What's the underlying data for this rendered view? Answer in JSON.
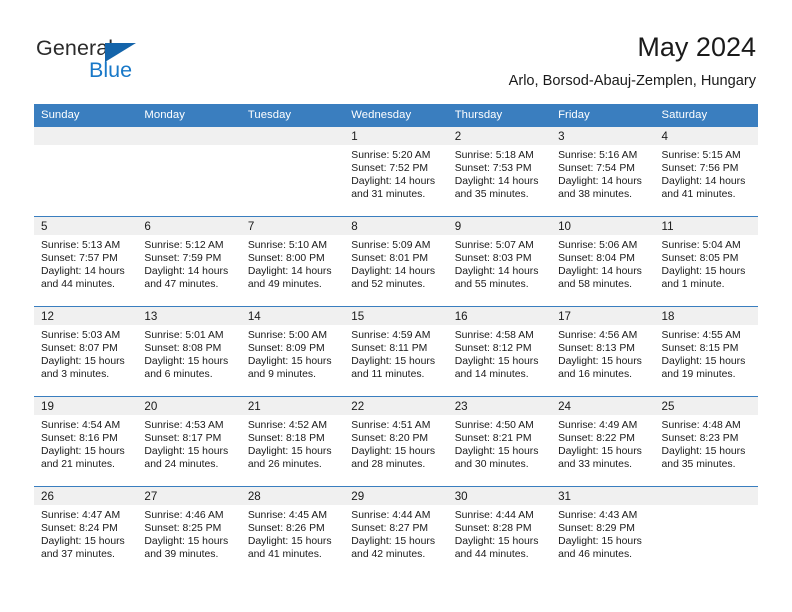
{
  "brand": {
    "word1": "General",
    "word2": "Blue",
    "accent_color": "#1878c8",
    "triangle_color": "#1464aa"
  },
  "header": {
    "month_title": "May 2024",
    "location": "Arlo, Borsod-Abauj-Zemplen, Hungary"
  },
  "calendar": {
    "header_color": "#3a7ebf",
    "weekdays": [
      "Sunday",
      "Monday",
      "Tuesday",
      "Wednesday",
      "Thursday",
      "Friday",
      "Saturday"
    ],
    "leading_blanks": 3,
    "weeks": [
      [
        {
          "blank": true
        },
        {
          "blank": true
        },
        {
          "blank": true
        },
        {
          "day": "1",
          "sunrise": "Sunrise: 5:20 AM",
          "sunset": "Sunset: 7:52 PM",
          "daylight1": "Daylight: 14 hours",
          "daylight2": "and 31 minutes."
        },
        {
          "day": "2",
          "sunrise": "Sunrise: 5:18 AM",
          "sunset": "Sunset: 7:53 PM",
          "daylight1": "Daylight: 14 hours",
          "daylight2": "and 35 minutes."
        },
        {
          "day": "3",
          "sunrise": "Sunrise: 5:16 AM",
          "sunset": "Sunset: 7:54 PM",
          "daylight1": "Daylight: 14 hours",
          "daylight2": "and 38 minutes."
        },
        {
          "day": "4",
          "sunrise": "Sunrise: 5:15 AM",
          "sunset": "Sunset: 7:56 PM",
          "daylight1": "Daylight: 14 hours",
          "daylight2": "and 41 minutes."
        }
      ],
      [
        {
          "day": "5",
          "sunrise": "Sunrise: 5:13 AM",
          "sunset": "Sunset: 7:57 PM",
          "daylight1": "Daylight: 14 hours",
          "daylight2": "and 44 minutes."
        },
        {
          "day": "6",
          "sunrise": "Sunrise: 5:12 AM",
          "sunset": "Sunset: 7:59 PM",
          "daylight1": "Daylight: 14 hours",
          "daylight2": "and 47 minutes."
        },
        {
          "day": "7",
          "sunrise": "Sunrise: 5:10 AM",
          "sunset": "Sunset: 8:00 PM",
          "daylight1": "Daylight: 14 hours",
          "daylight2": "and 49 minutes."
        },
        {
          "day": "8",
          "sunrise": "Sunrise: 5:09 AM",
          "sunset": "Sunset: 8:01 PM",
          "daylight1": "Daylight: 14 hours",
          "daylight2": "and 52 minutes."
        },
        {
          "day": "9",
          "sunrise": "Sunrise: 5:07 AM",
          "sunset": "Sunset: 8:03 PM",
          "daylight1": "Daylight: 14 hours",
          "daylight2": "and 55 minutes."
        },
        {
          "day": "10",
          "sunrise": "Sunrise: 5:06 AM",
          "sunset": "Sunset: 8:04 PM",
          "daylight1": "Daylight: 14 hours",
          "daylight2": "and 58 minutes."
        },
        {
          "day": "11",
          "sunrise": "Sunrise: 5:04 AM",
          "sunset": "Sunset: 8:05 PM",
          "daylight1": "Daylight: 15 hours",
          "daylight2": "and 1 minute."
        }
      ],
      [
        {
          "day": "12",
          "sunrise": "Sunrise: 5:03 AM",
          "sunset": "Sunset: 8:07 PM",
          "daylight1": "Daylight: 15 hours",
          "daylight2": "and 3 minutes."
        },
        {
          "day": "13",
          "sunrise": "Sunrise: 5:01 AM",
          "sunset": "Sunset: 8:08 PM",
          "daylight1": "Daylight: 15 hours",
          "daylight2": "and 6 minutes."
        },
        {
          "day": "14",
          "sunrise": "Sunrise: 5:00 AM",
          "sunset": "Sunset: 8:09 PM",
          "daylight1": "Daylight: 15 hours",
          "daylight2": "and 9 minutes."
        },
        {
          "day": "15",
          "sunrise": "Sunrise: 4:59 AM",
          "sunset": "Sunset: 8:11 PM",
          "daylight1": "Daylight: 15 hours",
          "daylight2": "and 11 minutes."
        },
        {
          "day": "16",
          "sunrise": "Sunrise: 4:58 AM",
          "sunset": "Sunset: 8:12 PM",
          "daylight1": "Daylight: 15 hours",
          "daylight2": "and 14 minutes."
        },
        {
          "day": "17",
          "sunrise": "Sunrise: 4:56 AM",
          "sunset": "Sunset: 8:13 PM",
          "daylight1": "Daylight: 15 hours",
          "daylight2": "and 16 minutes."
        },
        {
          "day": "18",
          "sunrise": "Sunrise: 4:55 AM",
          "sunset": "Sunset: 8:15 PM",
          "daylight1": "Daylight: 15 hours",
          "daylight2": "and 19 minutes."
        }
      ],
      [
        {
          "day": "19",
          "sunrise": "Sunrise: 4:54 AM",
          "sunset": "Sunset: 8:16 PM",
          "daylight1": "Daylight: 15 hours",
          "daylight2": "and 21 minutes."
        },
        {
          "day": "20",
          "sunrise": "Sunrise: 4:53 AM",
          "sunset": "Sunset: 8:17 PM",
          "daylight1": "Daylight: 15 hours",
          "daylight2": "and 24 minutes."
        },
        {
          "day": "21",
          "sunrise": "Sunrise: 4:52 AM",
          "sunset": "Sunset: 8:18 PM",
          "daylight1": "Daylight: 15 hours",
          "daylight2": "and 26 minutes."
        },
        {
          "day": "22",
          "sunrise": "Sunrise: 4:51 AM",
          "sunset": "Sunset: 8:20 PM",
          "daylight1": "Daylight: 15 hours",
          "daylight2": "and 28 minutes."
        },
        {
          "day": "23",
          "sunrise": "Sunrise: 4:50 AM",
          "sunset": "Sunset: 8:21 PM",
          "daylight1": "Daylight: 15 hours",
          "daylight2": "and 30 minutes."
        },
        {
          "day": "24",
          "sunrise": "Sunrise: 4:49 AM",
          "sunset": "Sunset: 8:22 PM",
          "daylight1": "Daylight: 15 hours",
          "daylight2": "and 33 minutes."
        },
        {
          "day": "25",
          "sunrise": "Sunrise: 4:48 AM",
          "sunset": "Sunset: 8:23 PM",
          "daylight1": "Daylight: 15 hours",
          "daylight2": "and 35 minutes."
        }
      ],
      [
        {
          "day": "26",
          "sunrise": "Sunrise: 4:47 AM",
          "sunset": "Sunset: 8:24 PM",
          "daylight1": "Daylight: 15 hours",
          "daylight2": "and 37 minutes."
        },
        {
          "day": "27",
          "sunrise": "Sunrise: 4:46 AM",
          "sunset": "Sunset: 8:25 PM",
          "daylight1": "Daylight: 15 hours",
          "daylight2": "and 39 minutes."
        },
        {
          "day": "28",
          "sunrise": "Sunrise: 4:45 AM",
          "sunset": "Sunset: 8:26 PM",
          "daylight1": "Daylight: 15 hours",
          "daylight2": "and 41 minutes."
        },
        {
          "day": "29",
          "sunrise": "Sunrise: 4:44 AM",
          "sunset": "Sunset: 8:27 PM",
          "daylight1": "Daylight: 15 hours",
          "daylight2": "and 42 minutes."
        },
        {
          "day": "30",
          "sunrise": "Sunrise: 4:44 AM",
          "sunset": "Sunset: 8:28 PM",
          "daylight1": "Daylight: 15 hours",
          "daylight2": "and 44 minutes."
        },
        {
          "day": "31",
          "sunrise": "Sunrise: 4:43 AM",
          "sunset": "Sunset: 8:29 PM",
          "daylight1": "Daylight: 15 hours",
          "daylight2": "and 46 minutes."
        },
        {
          "blank": true
        }
      ]
    ]
  }
}
